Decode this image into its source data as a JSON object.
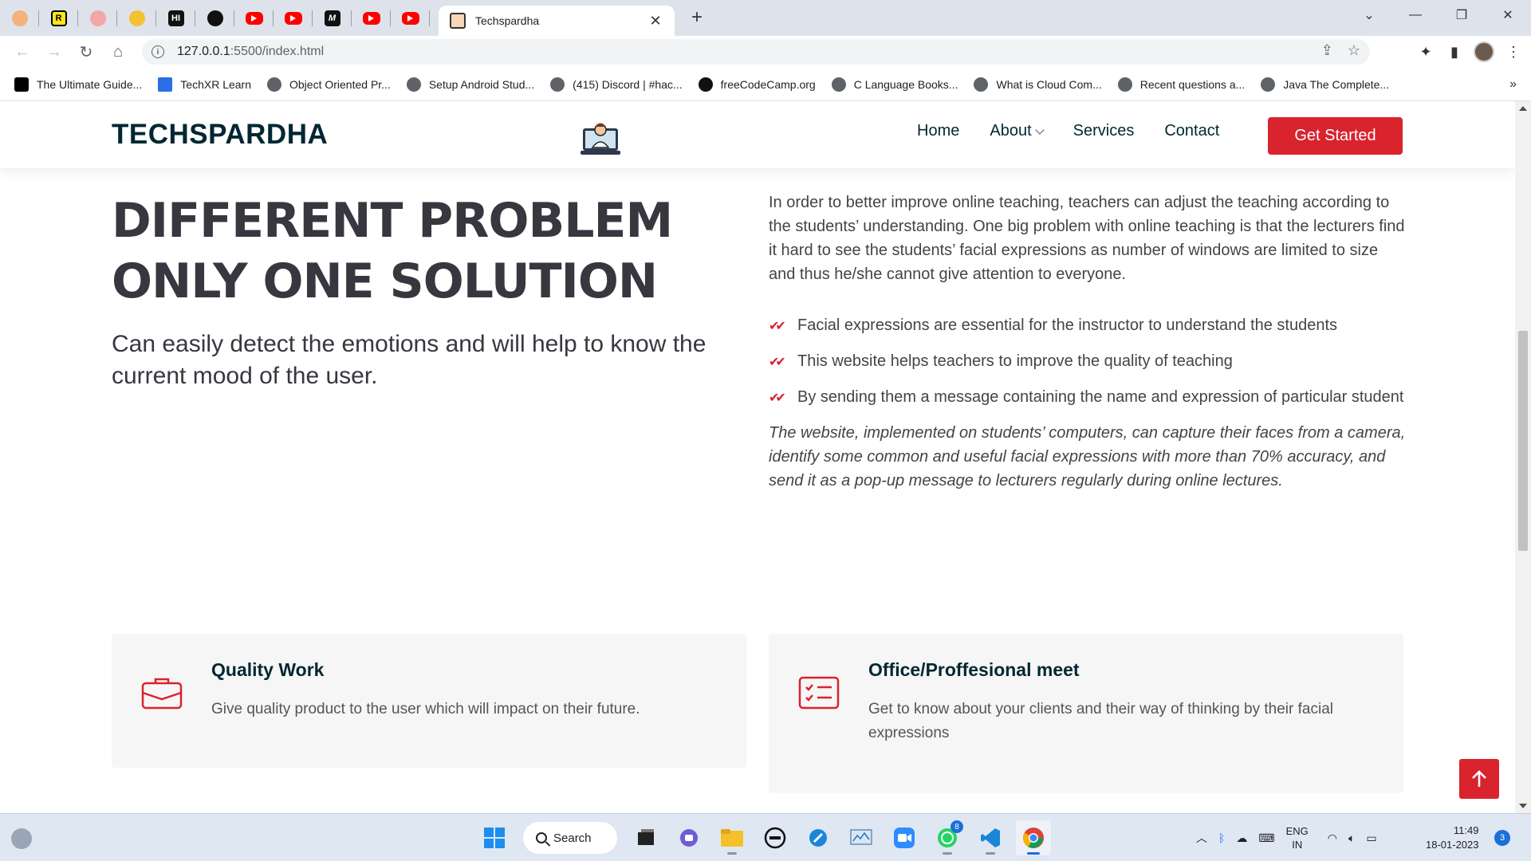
{
  "browser": {
    "pinned_tabs": [
      {
        "icon": "avatar-tab-icon"
      },
      {
        "icon": "r-letter-tab-icon",
        "label": "R"
      },
      {
        "icon": "swirl-tab-icon"
      },
      {
        "icon": "bug-tab-icon"
      },
      {
        "icon": "hi-tab-icon",
        "label": "HI"
      },
      {
        "icon": "github-tab-icon"
      },
      {
        "icon": "youtube-tab-icon"
      },
      {
        "icon": "youtube-tab-icon"
      },
      {
        "icon": "m-letter-tab-icon",
        "label": "M"
      },
      {
        "icon": "youtube-tab-icon"
      },
      {
        "icon": "youtube-tab-icon"
      }
    ],
    "active_tab": {
      "title": "Techspardha",
      "close": "✕"
    },
    "new_tab": "+",
    "window_controls": {
      "dropdown": "⌄",
      "minimize": "—",
      "restore": "❐",
      "close": "✕"
    },
    "nav": {
      "back": "←",
      "forward": "→",
      "reload": "↻",
      "home": "⌂"
    },
    "url_host": "127.0.0.1",
    "url_path": ":5500/index.html",
    "bookmarks": [
      {
        "label": "The Ultimate Guide...",
        "icon": "ultimate-guide-icon"
      },
      {
        "label": "TechXR Learn",
        "icon": "techxr-icon"
      },
      {
        "label": "Object Oriented Pr...",
        "icon": "globe-icon"
      },
      {
        "label": "Setup Android Stud...",
        "icon": "globe-icon"
      },
      {
        "label": "(415) Discord | #hac...",
        "icon": "globe-icon"
      },
      {
        "label": "freeCodeCamp.org",
        "icon": "github-icon"
      },
      {
        "label": "C Language Books...",
        "icon": "globe-icon"
      },
      {
        "label": "What is Cloud Com...",
        "icon": "globe-icon"
      },
      {
        "label": "Recent questions a...",
        "icon": "globe-icon"
      },
      {
        "label": "Java The Complete...",
        "icon": "globe-icon"
      }
    ],
    "bookmarks_more": "»"
  },
  "site": {
    "logo": "TECHSPARDHA",
    "nav": {
      "home": "Home",
      "about": "About",
      "services": "Services",
      "contact": "Contact"
    },
    "cta": "Get Started",
    "hero_title": "DIFFERENT PROBLEM ONLY ONE SOLUTION",
    "hero_subtitle": "Can easily detect the emotions and will help to know the current mood of the user.",
    "intro": "In order to better improve online teaching, teachers can adjust the teaching according to the students’ understanding. One big problem with online teaching is that the lecturers find it hard to see the students’ facial expressions as number of windows are limited to size and thus he/she cannot give attention to everyone.",
    "checklist": [
      "Facial expressions are essential for the instructor to understand the students",
      "This website helps teachers to improve the quality of teaching",
      "By sending them a message containing the name and expression of particular student"
    ],
    "italic_note": "The website, implemented on students’ computers, can capture their faces from a camera, identify some common and useful facial expressions with more than 70% accuracy, and send it as a pop-up message to lecturers regularly during online lectures.",
    "cards": [
      {
        "title": "Quality Work",
        "desc": "Give quality product to the user which will impact on their future.",
        "icon": "briefcase-icon"
      },
      {
        "title": "Office/Proffesional meet",
        "desc": "Get to know about your clients and their way of thinking by their facial expressions",
        "icon": "checklist-icon"
      }
    ],
    "accent_color": "#d9232d",
    "heading_color": "#012732"
  },
  "taskbar": {
    "search_label": "Search",
    "whatsapp_badge": "8",
    "lang_top": "ENG",
    "lang_bottom": "IN",
    "time": "11:49",
    "date": "18-01-2023",
    "notifications": "3"
  }
}
